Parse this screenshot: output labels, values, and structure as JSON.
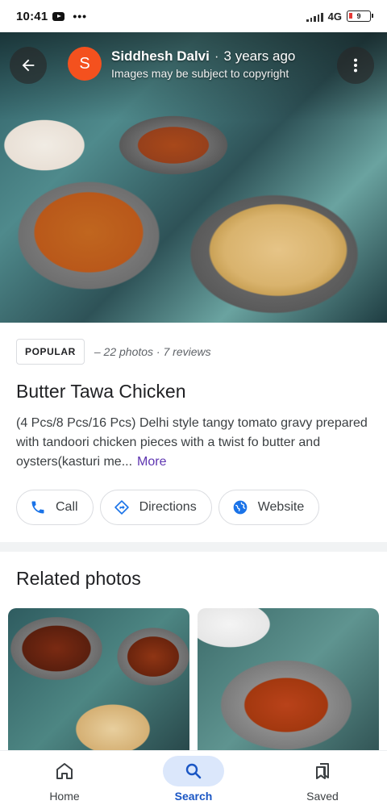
{
  "status_bar": {
    "time": "10:41",
    "overflow": "•••",
    "network": "4G",
    "battery": "9"
  },
  "photo_header": {
    "avatar_letter": "S",
    "author": "Siddhesh Dalvi",
    "separator": "·",
    "age": "3 years ago",
    "copyright_note": "Images may be subject to copyright"
  },
  "details": {
    "badge": "POPULAR",
    "meta": "– 22 photos · 7 reviews",
    "title": "Butter Tawa Chicken",
    "description": "(4 Pcs/8 Pcs/16 Pcs) Delhi style tangy tomato gravy prepared with tandoori chicken pieces with a twist fo butter and oysters(kasturi me...",
    "more_label": "More"
  },
  "actions": {
    "call_label": "Call",
    "directions_label": "Directions",
    "website_label": "Website"
  },
  "related": {
    "title": "Related photos"
  },
  "bottom_nav": {
    "home_label": "Home",
    "search_label": "Search",
    "saved_label": "Saved"
  },
  "colors": {
    "accent": "#1a73e8",
    "avatar": "#f4511e",
    "more_link": "#5e35b1",
    "active_nav_bg": "#dbe7fb"
  }
}
